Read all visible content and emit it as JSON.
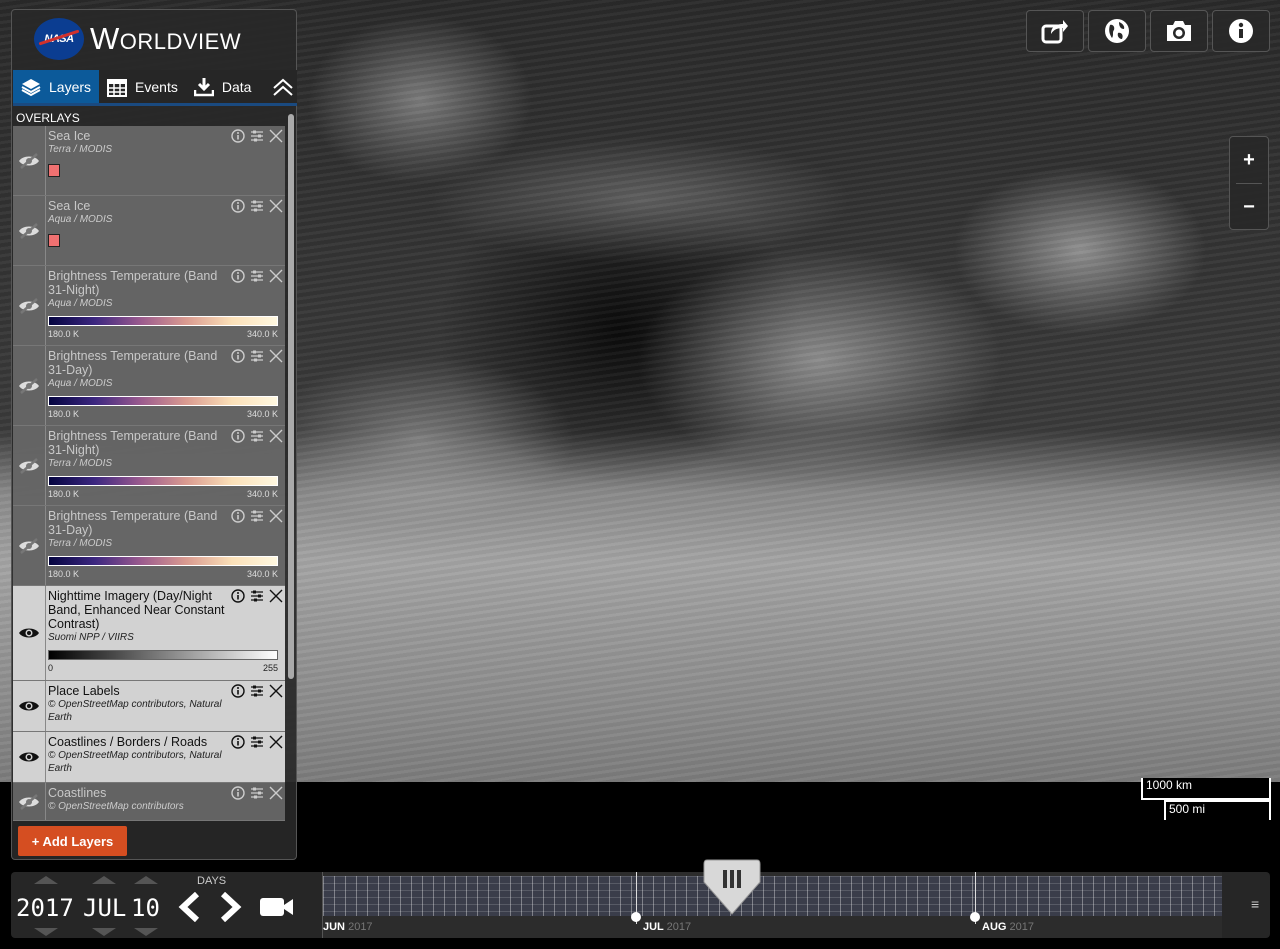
{
  "app": {
    "logo_text": "NASA",
    "title": "Worldview"
  },
  "tabs": [
    {
      "label": "Layers",
      "icon": "layers-icon",
      "active": true
    },
    {
      "label": "Events",
      "icon": "calendar-icon",
      "active": false
    },
    {
      "label": "Data",
      "icon": "download-icon",
      "active": false
    }
  ],
  "sidebar": {
    "section_title": "OVERLAYS",
    "add_layers_label": "+ Add Layers",
    "layers": [
      {
        "name": "Sea Ice",
        "source": "Terra / MODIS",
        "visible": false,
        "legend": "swatch"
      },
      {
        "name": "Sea Ice",
        "source": "Aqua / MODIS",
        "visible": false,
        "legend": "swatch"
      },
      {
        "name": "Brightness Temperature (Band 31-Night)",
        "source": "Aqua / MODIS",
        "visible": false,
        "legend": "colorbar",
        "min": "180.0 K",
        "max": "340.0 K"
      },
      {
        "name": "Brightness Temperature (Band 31-Day)",
        "source": "Aqua / MODIS",
        "visible": false,
        "legend": "colorbar",
        "min": "180.0 K",
        "max": "340.0 K"
      },
      {
        "name": "Brightness Temperature (Band 31-Night)",
        "source": "Terra / MODIS",
        "visible": false,
        "legend": "colorbar",
        "min": "180.0 K",
        "max": "340.0 K"
      },
      {
        "name": "Brightness Temperature (Band 31-Day)",
        "source": "Terra / MODIS",
        "visible": false,
        "legend": "colorbar",
        "min": "180.0 K",
        "max": "340.0 K"
      },
      {
        "name": "Nighttime Imagery (Day/Night Band, Enhanced Near Constant Contrast)",
        "source": "Suomi NPP / VIIRS",
        "visible": true,
        "legend": "graybar",
        "min": "0",
        "max": "255"
      },
      {
        "name": "Place Labels",
        "source": "© OpenStreetMap contributors, Natural Earth",
        "visible": true,
        "legend": "none"
      },
      {
        "name": "Coastlines / Borders / Roads",
        "source": "© OpenStreetMap contributors, Natural Earth",
        "visible": true,
        "legend": "none"
      },
      {
        "name": "Coastlines",
        "source": "© OpenStreetMap contributors",
        "visible": false,
        "legend": "none"
      }
    ]
  },
  "toolbar": {
    "share": "share-icon",
    "projection": "globe-icon",
    "snapshot": "camera-icon",
    "info": "info-icon"
  },
  "zoom": {
    "in_label": "+",
    "out_label": "−"
  },
  "scale": {
    "metric": "1000 km",
    "imperial": "500 mi"
  },
  "timeline": {
    "year": "2017",
    "month": "JUL",
    "day": "10",
    "interval_label": "DAYS",
    "months": [
      {
        "label": "JUN",
        "year": "2017"
      },
      {
        "label": "JUL",
        "year": "2017"
      },
      {
        "label": "AUG",
        "year": "2017"
      }
    ],
    "menu_icon": "≡"
  },
  "colors": {
    "accent": "#0c5a9a",
    "add_button": "#d54e21",
    "swatch": "#f07171"
  }
}
